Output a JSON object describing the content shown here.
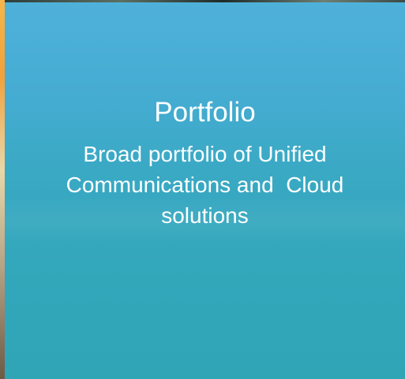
{
  "slide": {
    "title": "Portfolio",
    "body_line1": "Broad portfolio of Unified",
    "body_line2": "Communications and  Cloud",
    "body_line3": "solutions"
  },
  "colors": {
    "sky": "#4fb1da",
    "sea": "#33a7bb",
    "text": "#ffffff",
    "left_edge": "#f1a13a"
  }
}
